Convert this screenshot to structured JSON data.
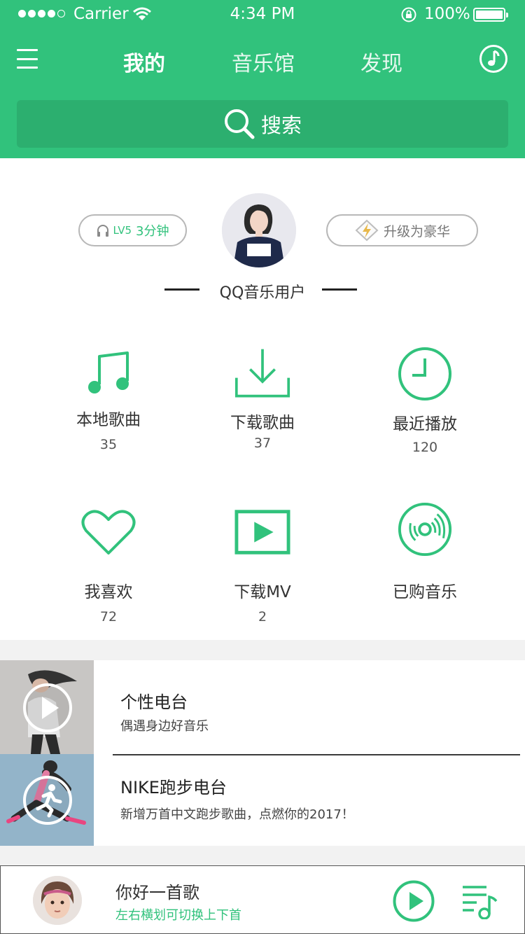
{
  "status_bar": {
    "carrier": "Carrier",
    "time": "4:34 PM",
    "battery": "100%"
  },
  "nav": {
    "tabs": [
      "我的",
      "音乐馆",
      "发现"
    ],
    "active_tab": "我的"
  },
  "search": {
    "label": "搜索"
  },
  "profile": {
    "level_badge": "LV5",
    "listen_time": "3分钟",
    "upgrade_label": "升级为豪华",
    "username": "QQ音乐用户"
  },
  "grid": [
    {
      "label": "本地歌曲",
      "count": "35",
      "icon": "music-note-icon"
    },
    {
      "label": "下载歌曲",
      "count": "37",
      "icon": "download-icon"
    },
    {
      "label": "最近播放",
      "count": "120",
      "icon": "clock-icon"
    },
    {
      "label": "我喜欢",
      "count": "72",
      "icon": "heart-icon"
    },
    {
      "label": "下载MV",
      "count": "2",
      "icon": "video-play-icon"
    },
    {
      "label": "已购音乐",
      "count": "",
      "icon": "vinyl-disc-icon"
    }
  ],
  "radio": [
    {
      "title": "个性电台",
      "subtitle": "偶遇身边好音乐",
      "icon": "play-circle-icon"
    },
    {
      "title": "NIKE跑步电台",
      "subtitle": "新增万首中文跑步歌曲，点燃你的2017！",
      "icon": "runner-icon"
    }
  ],
  "player": {
    "title": "你好一首歌",
    "hint": "左右横划可切换上下首"
  },
  "colors": {
    "brand_green": "#31c27c",
    "search_bg": "#2caf6f",
    "page_bg": "#f2f2f2"
  }
}
